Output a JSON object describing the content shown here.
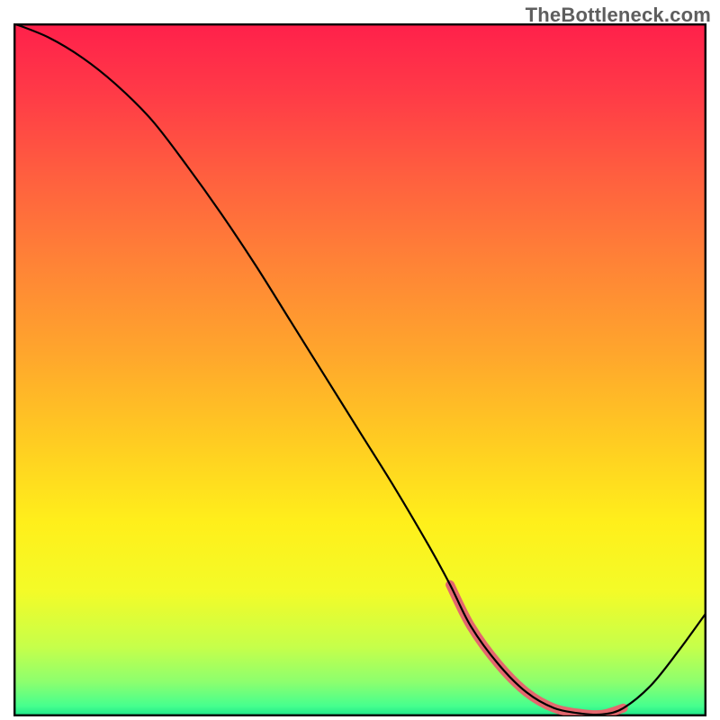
{
  "watermark": "TheBottleneck.com",
  "chart_data": {
    "type": "line",
    "title": "",
    "xlabel": "",
    "ylabel": "",
    "xlim": [
      0,
      100
    ],
    "ylim": [
      0,
      100
    ],
    "series": [
      {
        "name": "bottleneck-curve",
        "x": [
          0,
          5,
          10,
          15,
          20,
          25,
          30,
          35,
          40,
          45,
          50,
          55,
          60,
          63,
          66,
          70,
          74,
          78,
          82,
          85,
          88,
          92,
          96,
          100
        ],
        "values": [
          100,
          98,
          95,
          91,
          86,
          79.5,
          72.5,
          65,
          57,
          49,
          41,
          33,
          24.5,
          19,
          13,
          7.5,
          3.5,
          1.2,
          0.4,
          0.3,
          1.2,
          4.5,
          9.5,
          15
        ]
      },
      {
        "name": "highlight-band",
        "x": [
          63,
          66,
          70,
          74,
          78,
          82,
          85,
          88
        ],
        "values": [
          19,
          13,
          7.5,
          3.5,
          1.2,
          0.4,
          0.3,
          1.2
        ]
      }
    ],
    "gradient_bands": [
      {
        "stop": 0.0,
        "color": "#ff204b"
      },
      {
        "stop": 0.1,
        "color": "#ff3a47"
      },
      {
        "stop": 0.22,
        "color": "#ff5f3f"
      },
      {
        "stop": 0.35,
        "color": "#ff8436"
      },
      {
        "stop": 0.48,
        "color": "#ffa72c"
      },
      {
        "stop": 0.6,
        "color": "#ffcb22"
      },
      {
        "stop": 0.72,
        "color": "#ffef1b"
      },
      {
        "stop": 0.82,
        "color": "#f3fb28"
      },
      {
        "stop": 0.9,
        "color": "#c6ff4a"
      },
      {
        "stop": 0.95,
        "color": "#8dff6e"
      },
      {
        "stop": 0.985,
        "color": "#46ff8e"
      },
      {
        "stop": 1.0,
        "color": "#18e58a"
      }
    ],
    "colors": {
      "curve": "#000000",
      "highlight": "#e4676e",
      "border": "#000000"
    }
  }
}
